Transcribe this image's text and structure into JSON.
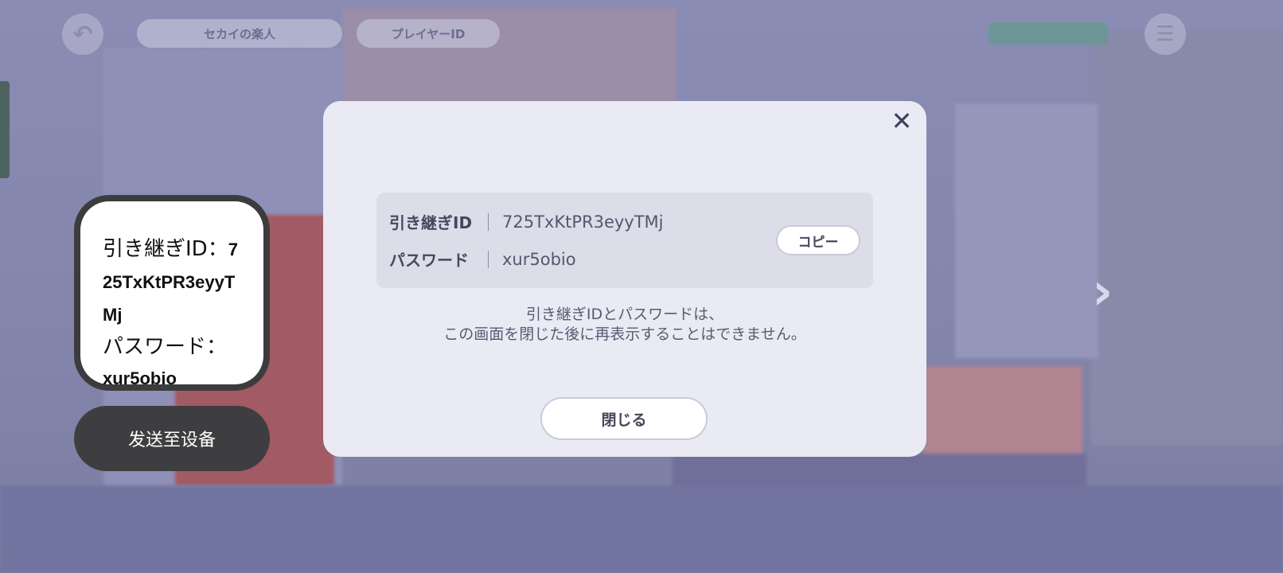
{
  "background": {
    "top_tab_1": "セカイの楽人",
    "top_tab_2": "プレイヤーID"
  },
  "overlay_card": {
    "id_label": "引き継ぎID：",
    "id_value": "725TxKtPR3eyyTMj",
    "password_label": "パスワード：",
    "password_value": "xur5obio"
  },
  "send_button": {
    "label": "发送至设备"
  },
  "modal": {
    "close_icon": "close-icon",
    "rows": [
      {
        "label": "引き継ぎID",
        "value": "725TxKtPR3eyyTMj"
      },
      {
        "label": "パスワード",
        "value": "xur5obio"
      }
    ],
    "copy_label": "コピー",
    "notice_line_1": "引き継ぎIDとパスワードは、",
    "notice_line_2": "この画面を閉じた後に再表示することはできません。",
    "close_button_label": "閉じる"
  },
  "colors": {
    "modal_bg": "#e9eaf3",
    "cred_box_bg": "#dcdde8",
    "text_dark": "#46475f",
    "overlay_dark": "#3c3c3e"
  }
}
